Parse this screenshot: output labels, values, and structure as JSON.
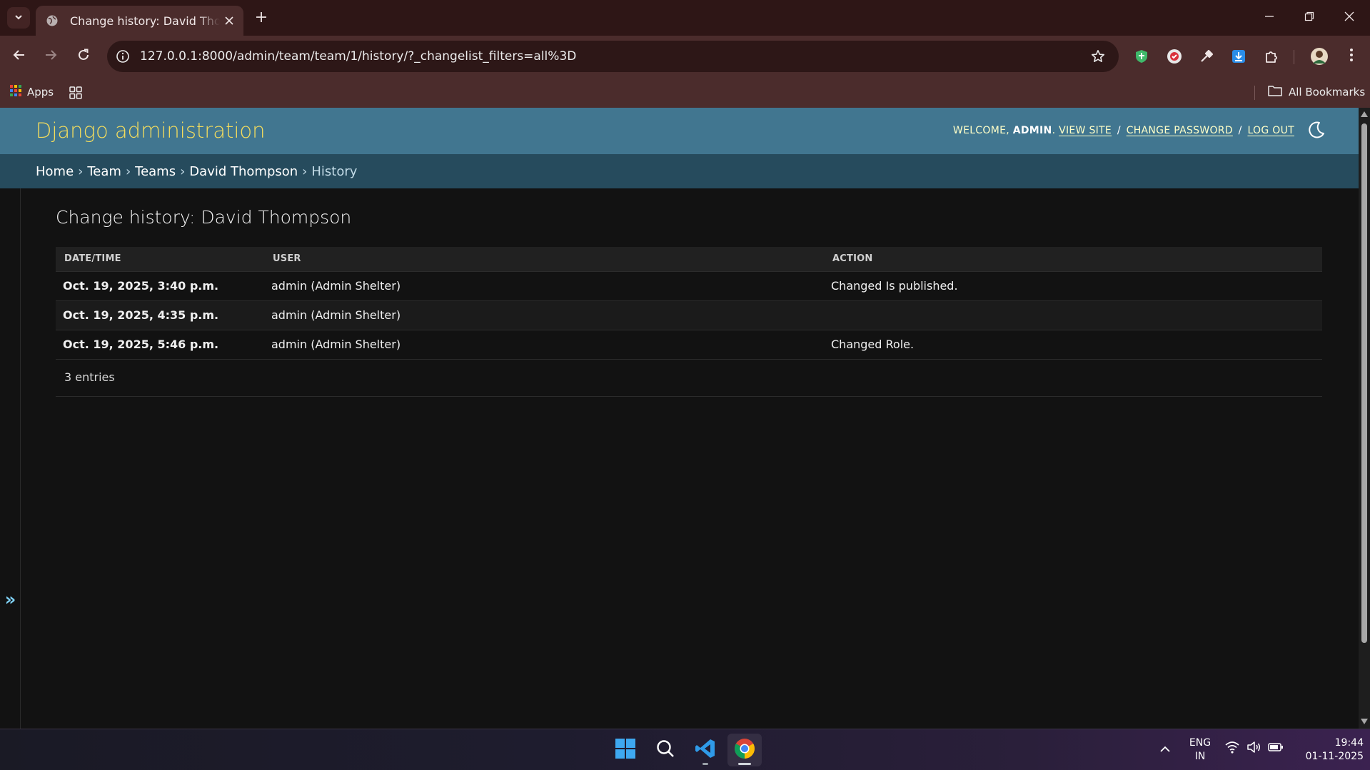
{
  "browser": {
    "tab": {
      "title": "Change history: David Thompson"
    },
    "address_bar": {
      "url": "127.0.0.1:8000/admin/team/team/1/history/?_changelist_filters=all%3D"
    },
    "bookmarks": {
      "apps_label": "Apps",
      "all_bookmarks_label": "All Bookmarks"
    }
  },
  "header": {
    "site_name": "Django administration",
    "welcome_prefix": "WELCOME,",
    "username": "ADMIN",
    "view_site": "VIEW SITE",
    "change_password": "CHANGE PASSWORD",
    "log_out": "LOG OUT",
    "separator": "/"
  },
  "breadcrumbs": {
    "items": [
      "Home",
      "Team",
      "Teams",
      "David Thompson"
    ],
    "current": "History",
    "separator": "›"
  },
  "sidebar": {
    "toggle_glyph": "»"
  },
  "main": {
    "title": "Change history: David Thompson",
    "columns": [
      "DATE/TIME",
      "USER",
      "ACTION"
    ],
    "rows": [
      {
        "datetime": "Oct. 19, 2025, 3:40 p.m.",
        "user": "admin (Admin Shelter)",
        "action": "Changed Is published."
      },
      {
        "datetime": "Oct. 19, 2025, 4:35 p.m.",
        "user": "admin (Admin Shelter)",
        "action": ""
      },
      {
        "datetime": "Oct. 19, 2025, 5:46 p.m.",
        "user": "admin (Admin Shelter)",
        "action": "Changed Role."
      }
    ],
    "entries_text": "3 entries"
  },
  "taskbar": {
    "language": "ENG",
    "region": "IN",
    "time": "19:44",
    "date": "01-11-2025"
  },
  "colors": {
    "header_bg": "#417690",
    "branding": "#f5dd5d",
    "breadcrumbs_bg": "#264b5d",
    "page_bg": "#121212",
    "chrome_frame": "#2e1616",
    "chrome_toolbar": "#4b2c2c"
  }
}
